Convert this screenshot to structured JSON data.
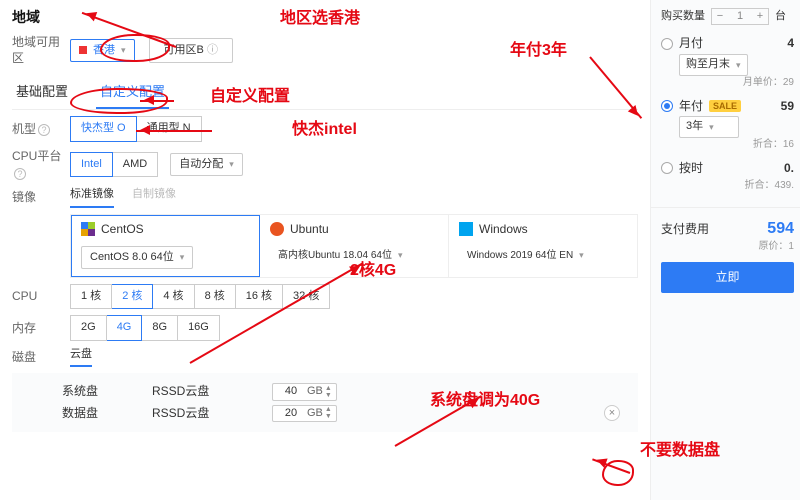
{
  "region": {
    "section": "地域",
    "label": "地域可用区",
    "selected": "香港",
    "zone": "可用区B",
    "zone_hint": "ⓘ"
  },
  "tabs": {
    "basic": "基础配置",
    "custom": "自定义配置"
  },
  "model": {
    "label": "机型",
    "opts": [
      "快杰型 O",
      "通用型 N"
    ]
  },
  "cpu_platform": {
    "label": "CPU平台",
    "opts": [
      "Intel",
      "AMD"
    ],
    "auto": "自动分配"
  },
  "image": {
    "label": "镜像",
    "sub": [
      "标准镜像",
      "自制镜像"
    ]
  },
  "os": [
    {
      "name": "CentOS",
      "ver": "CentOS 8.0 64位",
      "color": "#2d7bf4",
      "icon": "centos"
    },
    {
      "name": "Ubuntu",
      "ver": "高内核Ubuntu 18.04 64位",
      "color": "#e95420",
      "icon": "ubuntu"
    },
    {
      "name": "Windows",
      "ver": "Windows 2019 64位 EN",
      "color": "#00a4ef",
      "icon": "windows"
    }
  ],
  "cpu": {
    "label": "CPU",
    "opts": [
      "1 核",
      "2 核",
      "4 核",
      "8 核",
      "16 核",
      "32 核"
    ]
  },
  "mem": {
    "label": "内存",
    "opts": [
      "2G",
      "4G",
      "8G",
      "16G"
    ]
  },
  "disk": {
    "label": "磁盘",
    "type": "云盘",
    "sys": {
      "name": "系统盘",
      "ty": "RSSD云盘",
      "val": "40",
      "unit": "GB"
    },
    "data": {
      "name": "数据盘",
      "ty": "RSSD云盘",
      "val": "20",
      "unit": "GB",
      "del": "×"
    }
  },
  "aside": {
    "buyqty": "购买数量",
    "qty": "1",
    "unit": "台",
    "m": {
      "lbl": "月付",
      "price": "4",
      "sel": "购至月末",
      "fine": "月单价：29"
    },
    "y": {
      "lbl": "年付",
      "sale": "SALE",
      "price": "59",
      "sel": "3年",
      "fine": "折合：16"
    },
    "h": {
      "lbl": "按时",
      "price": "0.",
      "fine": "折合：439."
    },
    "paylabel": "支付费用",
    "total": "594",
    "orig": "原价：1",
    "buy": "立即"
  },
  "notes": {
    "region": "地区选香港",
    "custom": "自定义配置",
    "model": "快杰intel",
    "spec": "2核4G",
    "sysdisk": "系统盘调为40G",
    "nodata": "不要数据盘",
    "year": "年付3年"
  }
}
